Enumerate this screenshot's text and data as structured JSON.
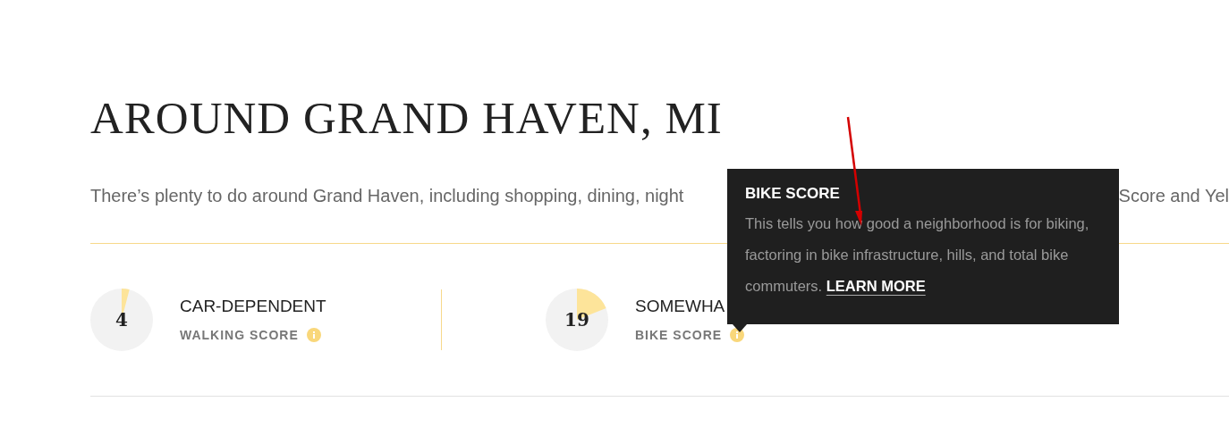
{
  "heading": "AROUND GRAND HAVEN, MI",
  "intro": {
    "before": "There’s plenty to do around Grand Haven, including shopping, dining, night",
    "after": "Score and Yel"
  },
  "scores": [
    {
      "value": "4",
      "rating": "CAR-DEPENDENT",
      "label": "WALKING SCORE"
    },
    {
      "value": "19",
      "rating": "SOMEWHA",
      "label": "BIKE SCORE"
    }
  ],
  "tooltip": {
    "title": "BIKE SCORE",
    "body": "This tells you how good a neighborhood is for biking, factoring in bike infrastructure, hills, and total bike commuters.",
    "link": "LEARN MORE"
  }
}
